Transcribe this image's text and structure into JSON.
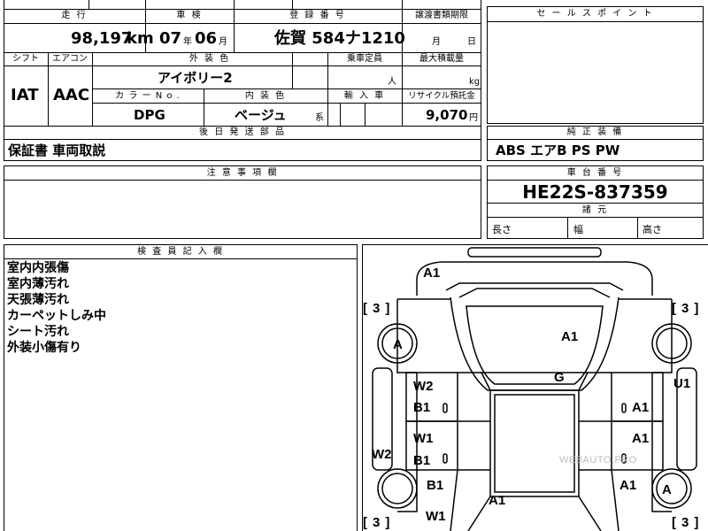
{
  "top_left": {
    "mileage_label": "走 行",
    "mileage_value": "98,197",
    "mileage_unit": "km",
    "inspection_label": "車 検",
    "inspection_year": "07",
    "inspection_year_unit": "年",
    "inspection_month": "06",
    "inspection_month_unit": "月",
    "registration_label": "登 録 番 号",
    "registration_value": "佐賀 584ナ1210",
    "transfer_label": "譲渡書類期限",
    "transfer_month_unit": "月",
    "transfer_day_unit": "日"
  },
  "row2": {
    "shift_label": "シフト",
    "aircon_label": "エアコン",
    "exterior_color_label": "外 装 色",
    "capacity_label": "乗車定員",
    "max_load_label": "最大積載量",
    "shift_value": "IAT",
    "aircon_value": "AAC",
    "exterior_color_value": "アイボリー2",
    "capacity_unit": "人",
    "max_load_unit": "kg",
    "color_no_label": "カ ラ ー N o .",
    "interior_color_label": "内 装 色",
    "import_label": "輸 入 車",
    "recycle_label": "リサイクル預託金",
    "color_no_value": "DPG",
    "interior_color_value": "ベージュ",
    "interior_color_suffix": "系",
    "recycle_value": "9,070",
    "recycle_unit": "円"
  },
  "later_parts": {
    "label": "後 日 発 送 部 品",
    "value": "保証書 車両取説"
  },
  "notes": {
    "label": "注 意 事 項 欄"
  },
  "sales_point": {
    "label": "セ ー ル ス ポ イ ン ト"
  },
  "equipment": {
    "label": "純 正 装 備",
    "value": "ABS エアB PS PW"
  },
  "chassis": {
    "label": "車 台 番 号",
    "value": "HE22S-837359",
    "dims_label": "諸 元",
    "length_label": "長さ",
    "width_label": "幅",
    "height_label": "高さ"
  },
  "inspector": {
    "label": "検 査 員 記 入 欄",
    "lines": [
      "室内内張傷",
      "室内薄汚れ",
      "天張薄汚れ",
      "カーペットしみ中",
      "シート汚れ",
      "外装小傷有り"
    ]
  },
  "diagram": {
    "codes": {
      "a1_top": "A1",
      "a1_roof": "A1",
      "g": "G",
      "w2_left": "W2",
      "b1_left_upper": "B1",
      "w1_left": "W1",
      "b1_left_lower": "B1",
      "b1_rear_left": "B1",
      "w1_bottom": "W1",
      "a1_bottom": "A1",
      "a1_right_upper": "A1",
      "a1_right_lower": "A1",
      "a1_rear_right": "A1",
      "u1": "U1",
      "w2_side": "W2",
      "a_left": "A",
      "a_right": "A"
    },
    "tire_tl": "3",
    "tire_tr": "3",
    "tire_bl": "3",
    "tire_br": "3",
    "bracket_open": "[",
    "bracket_close": "]",
    "watermark": "WEBAUTO.PRO"
  }
}
